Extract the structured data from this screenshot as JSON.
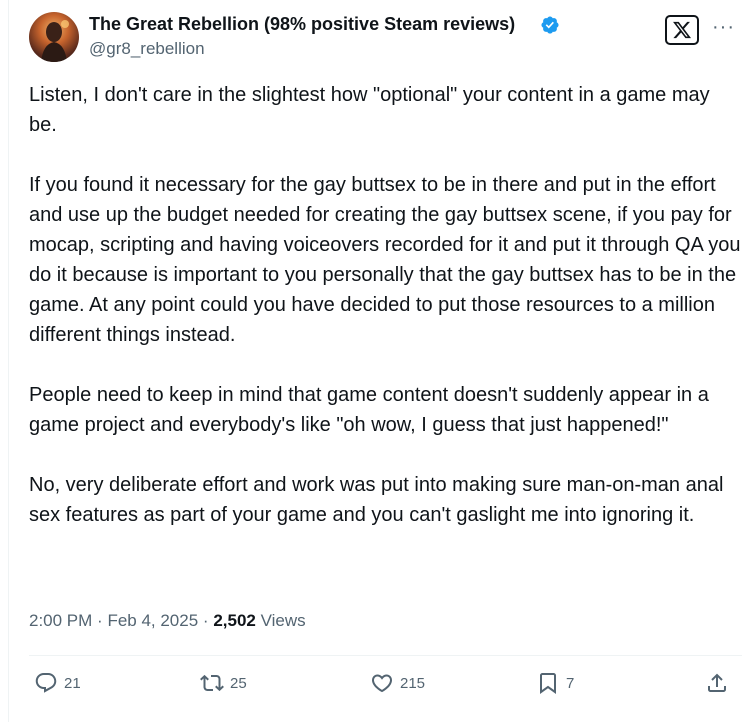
{
  "author": {
    "display_name": "The Great Rebellion (98% positive Steam reviews)",
    "handle": "@gr8_rebellion",
    "verified": true
  },
  "tweet": {
    "paragraphs": [
      "Listen, I don't care in the slightest how \"optional\" your content in a game may be.",
      "If you found it necessary for the gay buttsex to be in there and put in the effort and use up the budget needed for creating the gay buttsex scene, if you pay for mocap, scripting and having voiceovers recorded for it and put it through QA you do it because is important to you personally that the gay buttsex has to be in the game. At any point could you have decided to put those resources to a million different things instead.",
      "People need to keep in mind that game content doesn't suddenly appear in a game project and everybody's like \"oh wow, I guess that just happened!\"",
      "No, very deliberate effort and work was put into making sure man-on-man anal sex features as part of your game and you can't gaslight me into ignoring it."
    ],
    "time": "2:00 PM",
    "date": "Feb 4, 2025",
    "views_count": "2,502",
    "views_label": "Views"
  },
  "actions": {
    "replies": "21",
    "reposts": "25",
    "likes": "215",
    "bookmarks": "7"
  },
  "icons": {
    "verified": "verified-badge-icon",
    "brand": "x-logo-icon",
    "more": "more-icon",
    "reply": "reply-icon",
    "repost": "repost-icon",
    "like": "heart-icon",
    "bookmark": "bookmark-icon",
    "share": "share-icon"
  },
  "colors": {
    "text": "#0f1419",
    "secondary": "#536471",
    "verified": "#1d9bf0",
    "divider": "#eff3f4"
  }
}
